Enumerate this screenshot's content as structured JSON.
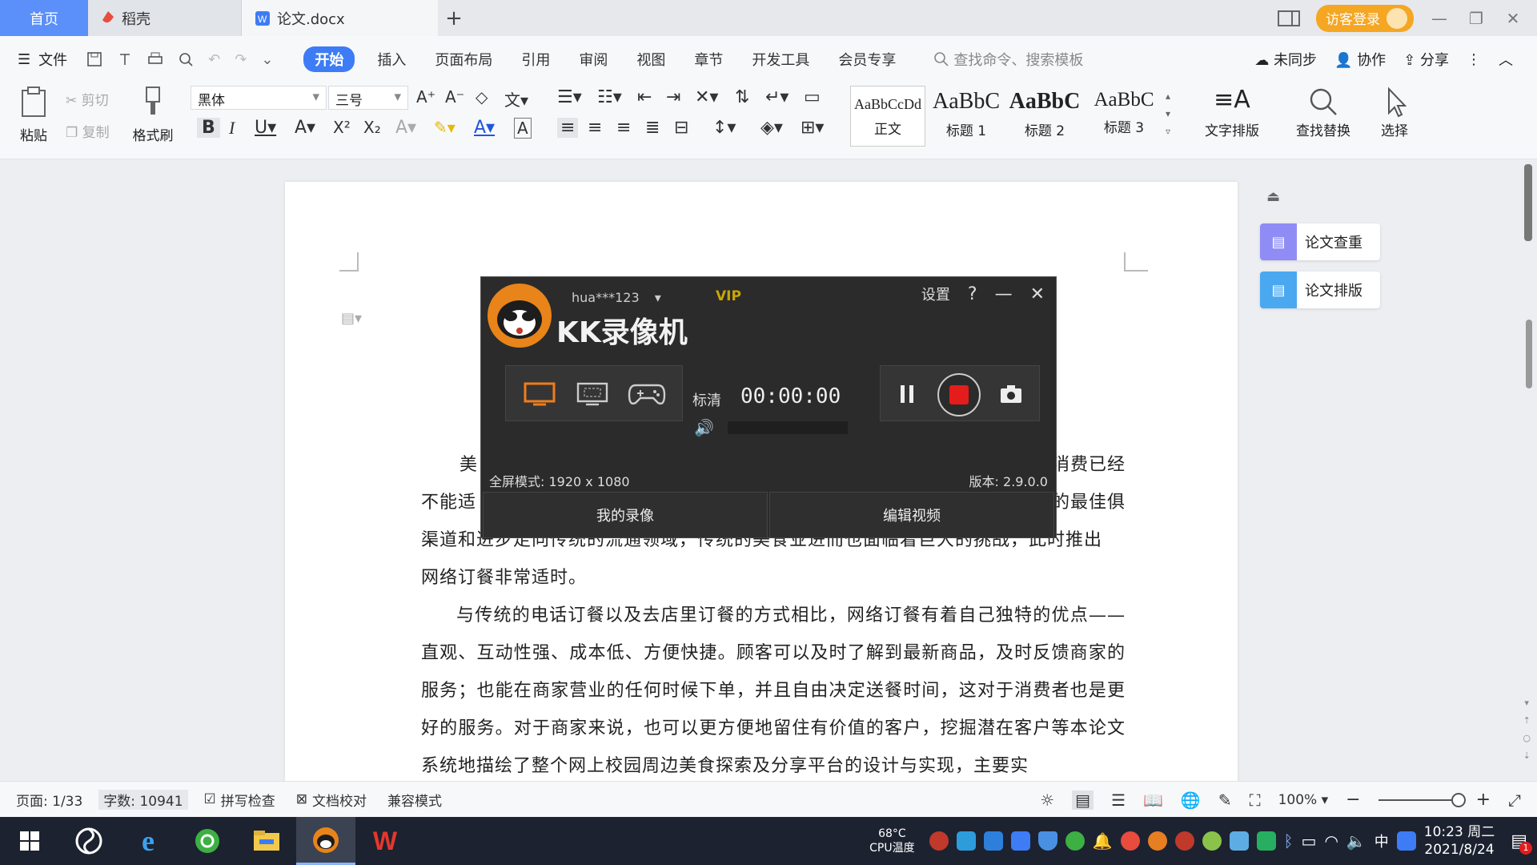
{
  "tabs": {
    "home": "首页",
    "docer": "稻壳",
    "document": "论文.docx",
    "add": "+"
  },
  "titlebar": {
    "login": "访客登录"
  },
  "menu": {
    "file": "文件",
    "items": [
      "开始",
      "插入",
      "页面布局",
      "引用",
      "审阅",
      "视图",
      "章节",
      "开发工具",
      "会员专享"
    ],
    "active_index": 0,
    "search_placeholder": "查找命令、搜索模板",
    "sync": "未同步",
    "collab": "协作",
    "share": "分享"
  },
  "ribbon": {
    "paste": "粘贴",
    "cut": "剪切",
    "copy": "复制",
    "format_painter": "格式刷",
    "font_name": "黑体",
    "font_size": "三号",
    "styles": [
      {
        "sample": "AaBbCcDd",
        "name": "正文"
      },
      {
        "sample": "AaBbC",
        "name": "标题 1"
      },
      {
        "sample": "AaBbC",
        "name": "标题 2"
      },
      {
        "sample": "AaBbC",
        "name": "标题 3"
      }
    ],
    "text_layout": "文字排版",
    "find_replace": "查找替换",
    "select": "选择"
  },
  "side_panel": {
    "check": "论文查重",
    "layout": "论文排版"
  },
  "document": {
    "p1_line1_start": "美",
    "p1_line1_end": "消费已经",
    "p1_line2_start": "不能适",
    "p1_line2_end": "的最佳俱",
    "p1_line3": "渠道和进步走向传统的流通领域，传统的美食业进而也面临着巨大的挑战，此时推出",
    "p1_line4": "网络订餐非常适时。",
    "p2": "与传统的电话订餐以及去店里订餐的方式相比，网络订餐有着自己独特的优点——直观、互动性强、成本低、方便快捷。顾客可以及时了解到最新商品，及时反馈商家的服务；也能在商家营业的任何时候下单，并且自由决定送餐时间，这对于消费者也是更好的服务。对于商家来说，也可以更方便地留住有价值的客户，挖掘潜在客户等本论文系统地描绘了整个网上校园周边美食探索及分享平台的设计与实现，主要实"
  },
  "recorder": {
    "user": "hua***123",
    "vip": "VIP",
    "title": "KK录像机",
    "settings": "设置",
    "help": "?",
    "quality": "标清",
    "time": "00:00:00",
    "mode": "全屏模式: 1920 x 1080",
    "version": "版本: 2.9.0.0",
    "my_recordings": "我的录像",
    "edit_video": "编辑视频"
  },
  "statusbar": {
    "page": "页面: 1/33",
    "word_count": "字数: 10941",
    "spell_check": "拼写检查",
    "proofread": "文档校对",
    "compat": "兼容模式",
    "zoom": "100%",
    "zoom_level": 1.0
  },
  "taskbar": {
    "cpu_temp": "68°C",
    "cpu_label": "CPU温度",
    "ime": "中",
    "time": "10:23 周二",
    "date": "2021/8/24",
    "notification_count": "1"
  }
}
